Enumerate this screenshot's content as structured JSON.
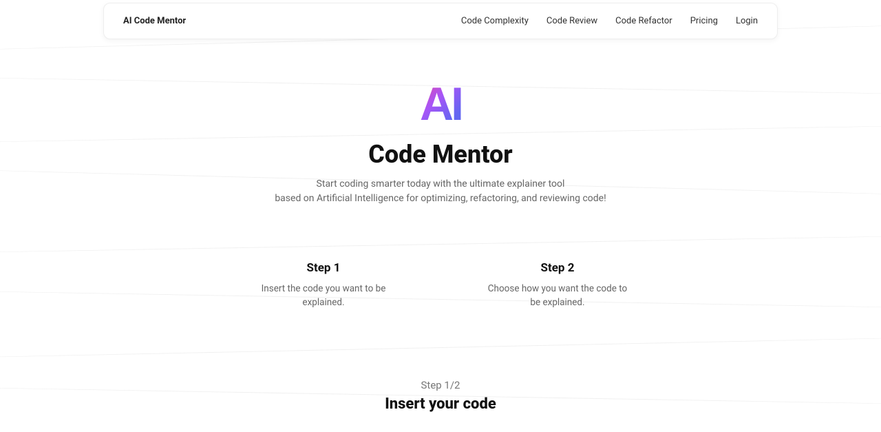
{
  "header": {
    "brand": "AI Code Mentor",
    "nav": {
      "complexity": "Code Complexity",
      "review": "Code Review",
      "refactor": "Code Refactor",
      "pricing": "Pricing",
      "login": "Login"
    }
  },
  "hero": {
    "logo_text": "AI",
    "title": "Code Mentor",
    "subtitle_line1": "Start coding smarter today with the ultimate explainer tool",
    "subtitle_line2": "based on Artificial Intelligence for optimizing, refactoring, and reviewing code!"
  },
  "steps": {
    "step1": {
      "title": "Step 1",
      "desc": "Insert the code you want to be explained."
    },
    "step2": {
      "title": "Step 2",
      "desc": "Choose how you want the code to be explained."
    }
  },
  "insert_section": {
    "counter": "Step 1/2",
    "title": "Insert your code"
  }
}
